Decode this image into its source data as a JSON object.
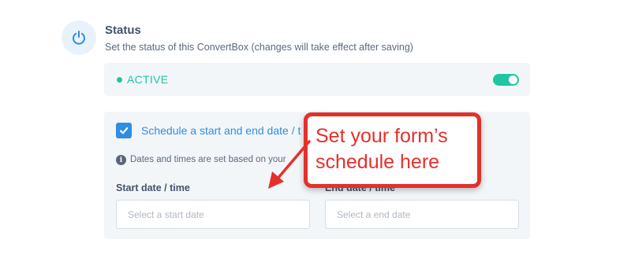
{
  "status_section": {
    "title": "Status",
    "description": "Set the status of this ConvertBox (changes will take effect after saving)",
    "status_label": "ACTIVE",
    "toggle_on": true,
    "icon": "power-icon"
  },
  "schedule": {
    "checkbox_checked": true,
    "checkbox_label": "Schedule a start and end date / t",
    "info_text": "Dates and times are set based on your",
    "start_label": "Start date / time",
    "start_placeholder": "Select a start date",
    "end_label": "End date / time",
    "end_placeholder": "Select a end date"
  },
  "callout": {
    "line1": "Set your form’s",
    "line2": "schedule here"
  },
  "colors": {
    "accent_green": "#1ec6a4",
    "accent_blue": "#2e8ee4",
    "callout_red": "#e4302b",
    "panel_bg": "#f3f6f9"
  }
}
